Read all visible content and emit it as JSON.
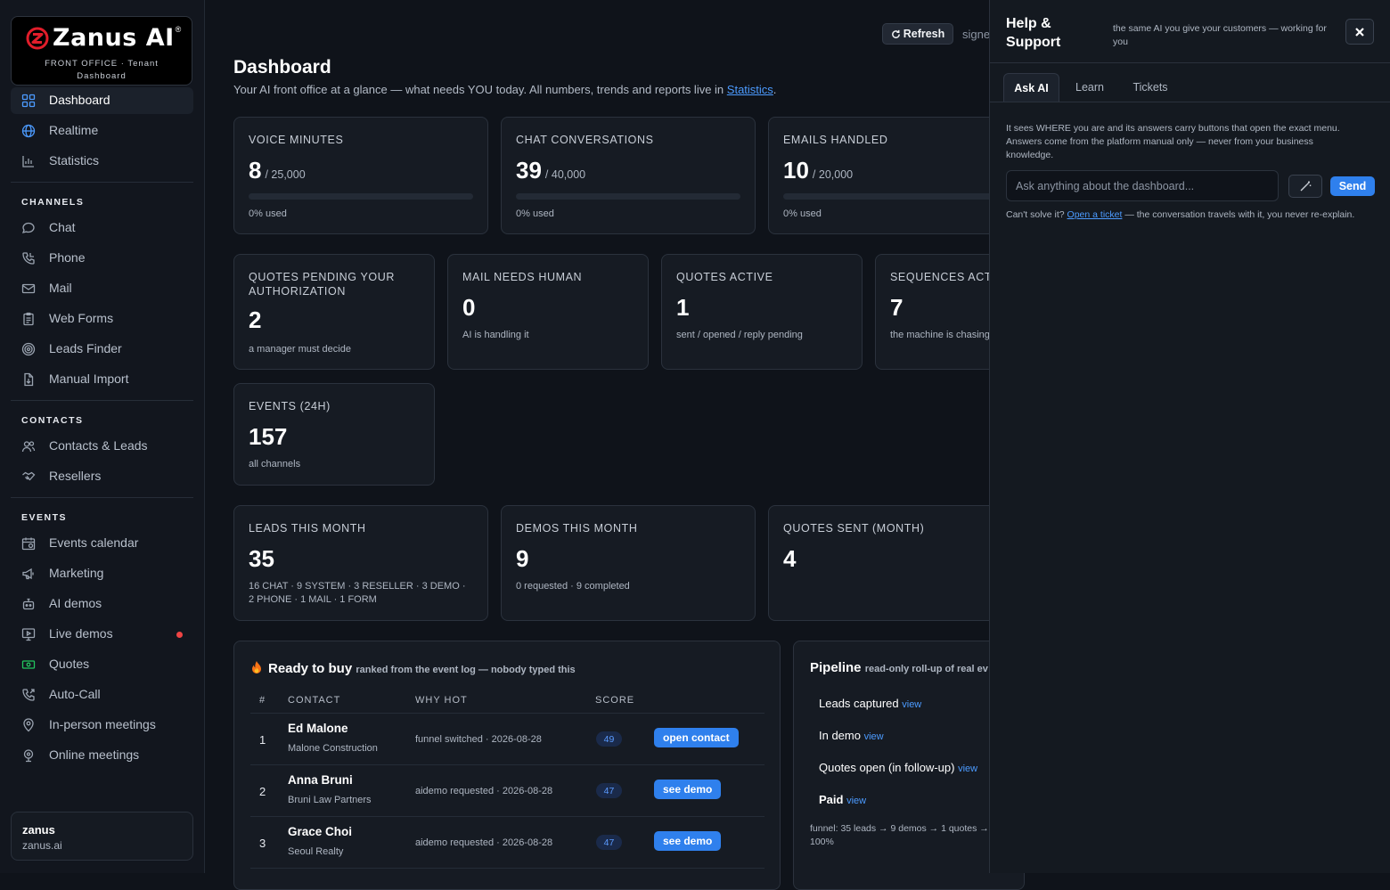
{
  "brand": {
    "name": "Zanus AI",
    "reg": "®",
    "sub_line1": "FRONT OFFICE · Tenant",
    "sub_line2": "Dashboard"
  },
  "nav": {
    "top": [
      {
        "label": "Dashboard",
        "icon": "grid-icon",
        "active": true
      },
      {
        "label": "Realtime",
        "icon": "globe-icon"
      },
      {
        "label": "Statistics",
        "icon": "bar-chart-icon"
      }
    ],
    "sections": [
      {
        "title": "CHANNELS",
        "items": [
          {
            "label": "Chat",
            "icon": "chat-bubble-icon"
          },
          {
            "label": "Phone",
            "icon": "phone-icon"
          },
          {
            "label": "Mail",
            "icon": "envelope-icon"
          },
          {
            "label": "Web Forms",
            "icon": "clipboard-icon"
          },
          {
            "label": "Leads Finder",
            "icon": "target-icon"
          },
          {
            "label": "Manual Import",
            "icon": "file-import-icon"
          }
        ]
      },
      {
        "title": "CONTACTS",
        "items": [
          {
            "label": "Contacts & Leads",
            "icon": "users-icon"
          },
          {
            "label": "Resellers",
            "icon": "handshake-icon"
          }
        ]
      },
      {
        "title": "EVENTS",
        "items": [
          {
            "label": "Events calendar",
            "icon": "calendar-icon"
          },
          {
            "label": "Marketing",
            "icon": "megaphone-icon"
          },
          {
            "label": "AI demos",
            "icon": "robot-icon"
          },
          {
            "label": "Live demos",
            "icon": "monitor-play-icon",
            "dot": true
          },
          {
            "label": "Quotes",
            "icon": "banknote-icon"
          },
          {
            "label": "Auto-Call",
            "icon": "phone-outgoing-icon"
          },
          {
            "label": "In-person meetings",
            "icon": "map-pin-icon"
          },
          {
            "label": "Online meetings",
            "icon": "webcam-icon"
          }
        ]
      }
    ]
  },
  "user": {
    "name": "zanus",
    "domain": "zanus.ai"
  },
  "header": {
    "refresh_label": "Refresh",
    "signed_text": "signe"
  },
  "page": {
    "title": "Dashboard",
    "subtitle": "Your AI front office at a glance — what needs YOU today. All numbers, trends and reports live in ",
    "subtitle_link": "Statistics",
    "subtitle_end": "."
  },
  "usage": [
    {
      "label": "VOICE MINUTES",
      "value": "8",
      "of": "/ 25,000",
      "used": "0% used",
      "fill_fraction": 0
    },
    {
      "label": "CHAT CONVERSATIONS",
      "value": "39",
      "of": "/ 40,000",
      "used": "0% used",
      "fill_fraction": 0
    },
    {
      "label": "EMAILS HANDLED",
      "value": "10",
      "of": "/ 20,000",
      "used": "0% used",
      "fill_fraction": 0
    }
  ],
  "status": [
    {
      "label": "QUOTES PENDING YOUR AUTHORIZATION",
      "value": "2",
      "sub": "a manager must decide"
    },
    {
      "label": "MAIL NEEDS HUMAN",
      "value": "0",
      "sub": "AI is handling it"
    },
    {
      "label": "QUOTES ACTIVE",
      "value": "1",
      "sub": "sent / opened / reply pending"
    },
    {
      "label": "SEQUENCES ACTIV",
      "value": "7",
      "sub": "the machine is chasing"
    },
    {
      "label": "EVENTS (24H)",
      "value": "157",
      "sub": "all channels"
    }
  ],
  "month": [
    {
      "label": "LEADS THIS MONTH",
      "value": "35",
      "sub": "16 CHAT · 9 SYSTEM · 3 RESELLER · 3 DEMO · 2 PHONE · 1 MAIL · 1 FORM"
    },
    {
      "label": "DEMOS THIS MONTH",
      "value": "9",
      "sub": "0 requested · 9 completed"
    },
    {
      "label": "QUOTES SENT (MONTH)",
      "value": "4",
      "sub": ""
    }
  ],
  "ready": {
    "icon": "fire-icon",
    "title": "Ready to buy",
    "subtitle": "ranked from the event log — nobody typed this",
    "columns": [
      "#",
      "CONTACT",
      "WHY HOT",
      "SCORE"
    ],
    "rows": [
      {
        "num": "1",
        "name": "Ed Malone",
        "company": "Malone Construction",
        "why": "funnel switched · 2026-08-28",
        "score": "49",
        "action": "open contact"
      },
      {
        "num": "2",
        "name": "Anna Bruni",
        "company": "Bruni Law Partners",
        "why": "aidemo requested · 2026-08-28",
        "score": "47",
        "action": "see demo"
      },
      {
        "num": "3",
        "name": "Grace Choi",
        "company": "Seoul Realty",
        "why": "aidemo requested · 2026-08-28",
        "score": "47",
        "action": "see demo"
      }
    ]
  },
  "pipeline": {
    "title": "Pipeline",
    "subtitle": "read-only roll-up of real ev",
    "items": [
      {
        "label": "Leads captured",
        "link": "view",
        "bold": false
      },
      {
        "label": "In demo",
        "link": "view",
        "bold": false
      },
      {
        "label": "Quotes open (in follow-up)",
        "link": "view",
        "bold": false
      },
      {
        "label": "Paid",
        "link": "view",
        "bold": true
      }
    ],
    "footer_line1": "funnel: 35 leads → 9 demos → 1 quotes →",
    "footer_line2": "100%"
  },
  "help": {
    "title_line1": "Help &",
    "title_line2": "Support",
    "subtitle": "the same AI you give your customers — working for you",
    "tabs": [
      "Ask AI",
      "Learn",
      "Tickets"
    ],
    "active_tab": "Ask AI",
    "description": "It sees WHERE you are and its answers carry buttons that open the exact menu. Answers come from the platform manual only — never from your business knowledge.",
    "input_placeholder": "Ask anything about the dashboard...",
    "send_label": "Send",
    "footer_pre": "Can't solve it? ",
    "footer_link": "Open a ticket",
    "footer_post": " — the conversation travels with it, you never re-explain."
  },
  "colors": {
    "accent": "#2f80ed",
    "link": "#4c9bff",
    "alert_dot": "#ef4444",
    "logo_red": "#e11d2a"
  }
}
